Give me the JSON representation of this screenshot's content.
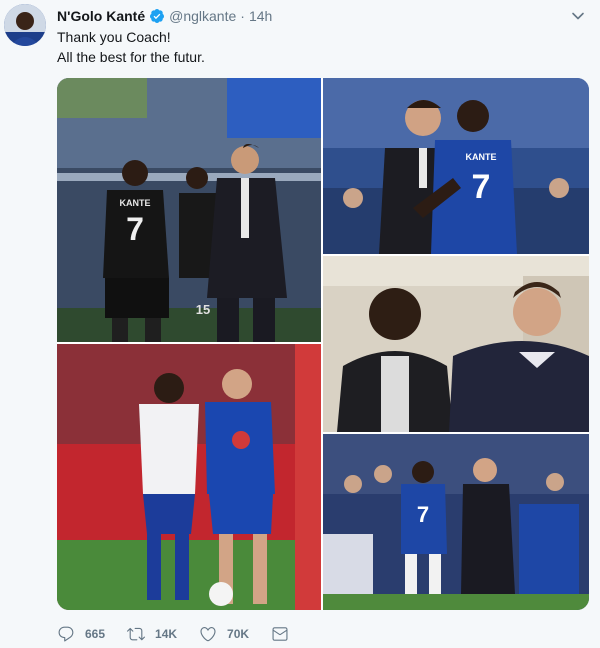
{
  "tweet": {
    "author_name": "N'Golo Kanté",
    "handle": "@nglkante",
    "separator": "·",
    "time": "14h",
    "text_lines": [
      "Thank you Coach!",
      "All the best for the futur."
    ],
    "jersey_name": "KANTE",
    "jersey_number": "7",
    "second_player_number": "15",
    "media_images": [
      "photo-celebration",
      "photo-embrace",
      "photo-indoor",
      "photo-training",
      "photo-touchline"
    ]
  },
  "actions": {
    "reply_count": "665",
    "retweet_count": "14K",
    "like_count": "70K"
  },
  "colors": {
    "verified": "#1da1f2",
    "action_icon": "#657786",
    "chelsea_blue": "#1a3c9a",
    "stadium_red": "#b0202a"
  }
}
